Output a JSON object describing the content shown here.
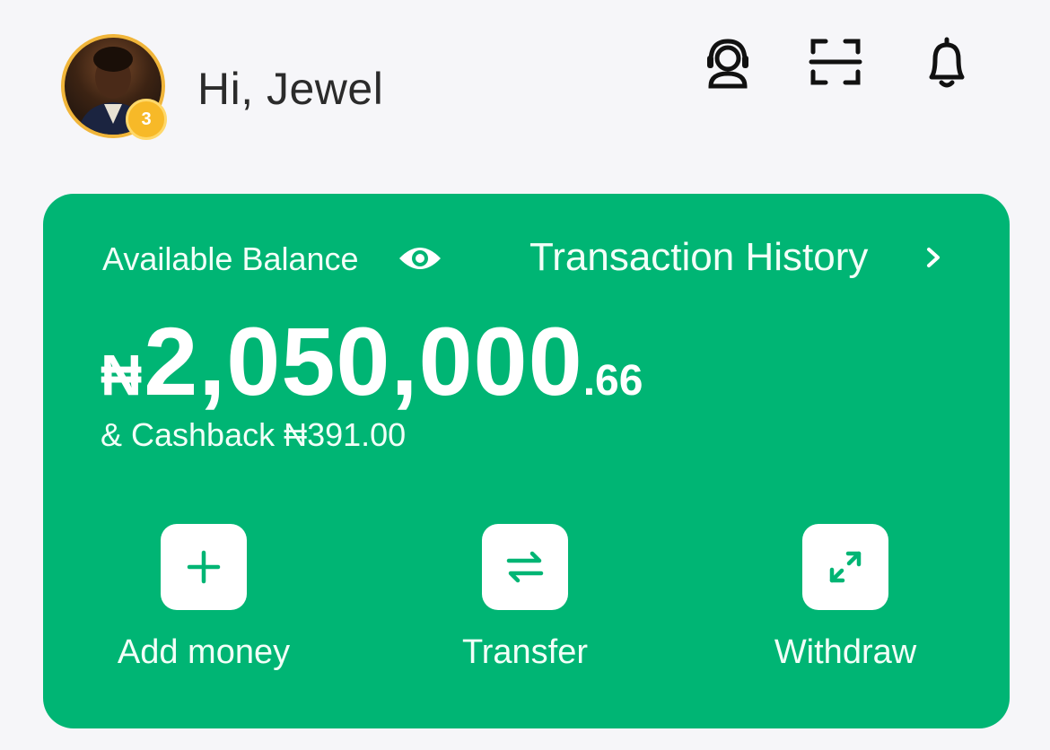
{
  "header": {
    "greeting": "Hi, Jewel",
    "avatar_badge": "3",
    "icons": [
      "headset-support-icon",
      "scan-icon",
      "bell-icon"
    ]
  },
  "balance_card": {
    "label": "Available Balance",
    "history_link": "Transaction History",
    "currency_symbol": "₦",
    "amount_main": "2,050,000",
    "amount_decimal": ".66",
    "cashback": "& Cashback ₦391.00",
    "accent_color": "#00b574"
  },
  "actions": [
    {
      "label": "Add money",
      "icon": "plus-icon"
    },
    {
      "label": "Transfer",
      "icon": "transfer-arrows-icon"
    },
    {
      "label": "Withdraw",
      "icon": "expand-arrows-icon"
    }
  ]
}
